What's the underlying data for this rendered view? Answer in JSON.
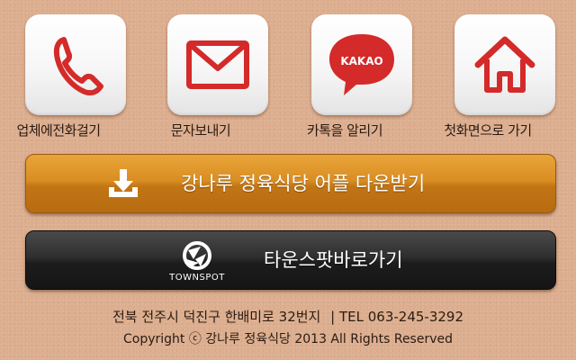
{
  "tiles": [
    {
      "label": "업체에전화걸기",
      "icon": "phone-icon"
    },
    {
      "label": "문자보내기",
      "icon": "envelope-icon"
    },
    {
      "label": "카톡을 알리기",
      "icon": "kakao-speech-bubble-icon",
      "icon_text": "KAKAO"
    },
    {
      "label": "첫화면으로 가기",
      "icon": "home-icon"
    }
  ],
  "download_bar": {
    "label": "강나루 정육식당 어플 다운받기",
    "icon": "download-icon",
    "color": "#d98d22"
  },
  "townspot_bar": {
    "label": "타운스팟바로가기",
    "logo_text": "TOWNSPOT",
    "color": "#2a2a2a"
  },
  "footer": {
    "address": "전북 전주시 덕진구 한배미로 32번지",
    "tel": "| TEL 063-245-3292",
    "copyright": "Copyright ⓒ 강나루 정육식당 2013 All Rights Reserved"
  },
  "colors": {
    "background": "#dcae8f",
    "icon_red": "#d42a2a",
    "text": "#2a1a12"
  }
}
